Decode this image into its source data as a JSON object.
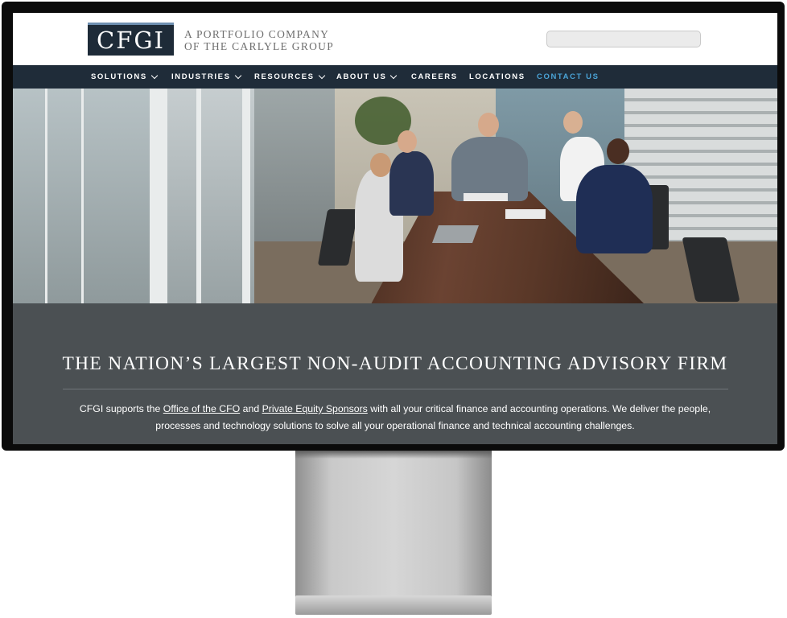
{
  "header": {
    "logo_text": "CFGI",
    "tagline_line1": "A PORTFOLIO COMPANY",
    "tagline_line2": "OF THE CARLYLE GROUP",
    "search": {
      "value": "",
      "placeholder": ""
    }
  },
  "nav": {
    "items": [
      {
        "label": "SOLUTIONS",
        "dropdown": true
      },
      {
        "label": "INDUSTRIES",
        "dropdown": true
      },
      {
        "label": "RESOURCES",
        "dropdown": true
      },
      {
        "label": "ABOUT US",
        "dropdown": true
      },
      {
        "label": "CAREERS",
        "dropdown": false
      },
      {
        "label": "LOCATIONS",
        "dropdown": false
      },
      {
        "label": "CONTACT US",
        "dropdown": false,
        "color": "#4aa3d6"
      }
    ]
  },
  "hero": {
    "alt": ""
  },
  "intro": {
    "headline": "THE NATION’S LARGEST NON-AUDIT ACCOUNTING ADVISORY FIRM",
    "paragraph_start": "CFGI supports the ",
    "link1": "Office of the CFO",
    "between": " and ",
    "link2": "Private Equity Sponsors",
    "paragraph_end": " with all your critical finance and accounting operations. We deliver the people, processes and technology solutions to solve all your operational finance and technical accounting challenges."
  },
  "colors": {
    "nav_bg": "#1f2c39",
    "logo_bg": "#1e2b38",
    "accent": "#4aa3d6",
    "band_bg": "#4b5053"
  }
}
